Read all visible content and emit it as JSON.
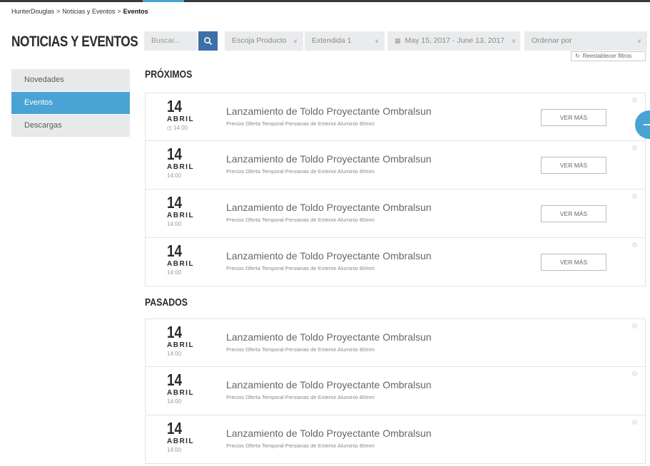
{
  "breadcrumb": {
    "items": [
      "HunterDouglas",
      "Noticias y Eventos",
      "Eventos"
    ],
    "separator": ">"
  },
  "page_title": "NOTICIAS Y EVENTOS",
  "sidebar": {
    "items": [
      {
        "label": "Novedades",
        "active": false
      },
      {
        "label": "Eventos",
        "active": true
      },
      {
        "label": "Descargas",
        "active": false
      }
    ]
  },
  "filters": {
    "search_placeholder": "Buscar...",
    "product_label": "Escoja Producto",
    "extension_label": "Extendida 1",
    "date_range": "May 15, 2017 - June 13, 2017",
    "order_label": "Ordenar por",
    "reset_label": "Reestablecer filtros"
  },
  "sections": {
    "upcoming_title": "PRÓXIMOS",
    "past_title": "PASADOS"
  },
  "upcoming_events": [
    {
      "day": "14",
      "month": "ABRIL",
      "time": "14:00",
      "title": "Lanzamiento de Toldo Proyectante Ombralsun",
      "subtitle": "Precios Oferta Temporal Persianas de Exterior Aluminio 80mm",
      "button": "VER MÁS"
    },
    {
      "day": "14",
      "month": "ABRIL",
      "time": "14:00",
      "title": "Lanzamiento de Toldo Proyectante Ombralsun",
      "subtitle": "Precios Oferta Temporal Persianas de Exterior Aluminio 80mm",
      "button": "VER MÁS"
    },
    {
      "day": "14",
      "month": "ABRIL",
      "time": "14:00",
      "title": "Lanzamiento de Toldo Proyectante Ombralsun",
      "subtitle": "Precios Oferta Temporal Persianas de Exterior Aluminio 80mm",
      "button": "VER MÁS"
    },
    {
      "day": "14",
      "month": "ABRIL",
      "time": "14:00",
      "title": "Lanzamiento de Toldo Proyectante Ombralsun",
      "subtitle": "Precios Oferta Temporal Persianas de Exterior Aluminio 80mm",
      "button": "VER MÁS"
    }
  ],
  "past_events": [
    {
      "day": "14",
      "month": "ABRIL",
      "time": "14:00",
      "title": "Lanzamiento de Toldo Proyectante Ombralsun",
      "subtitle": "Precios Oferta Temporal Persianas de Exterior Aluminio 80mm"
    },
    {
      "day": "14",
      "month": "ABRIL",
      "time": "14:00",
      "title": "Lanzamiento de Toldo Proyectante Ombralsun",
      "subtitle": "Precios Oferta Temporal Persianas de Exterior Aluminio 80mm"
    },
    {
      "day": "14",
      "month": "ABRIL",
      "time": "14:00",
      "title": "Lanzamiento de Toldo Proyectante Ombralsun",
      "subtitle": "Precios Oferta Temporal Persianas de Exterior Aluminio 80mm"
    }
  ],
  "colors": {
    "accent": "#4aa3d5",
    "search_button": "#3e6fa7",
    "filter_bg": "#eaebec",
    "sidebar_bg": "#e8e9ea",
    "title_text": "#2b2b2b"
  },
  "icons": {
    "search": "search-icon",
    "calendar": "calendar-icon",
    "refresh": "refresh-icon",
    "clock": "clock-icon",
    "settings": "gear-icon",
    "dropdown": "chevron-down-icon"
  }
}
